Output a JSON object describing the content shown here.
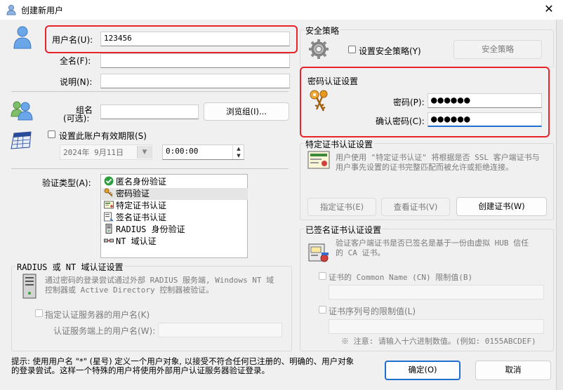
{
  "window": {
    "title": "创建新用户",
    "close_glyph": "✕"
  },
  "user": {
    "username_label": "用户名(U):",
    "username_value": "123456",
    "fullname_label": "全名(F):",
    "fullname_value": "",
    "desc_label": "说明(N):",
    "desc_value": ""
  },
  "group": {
    "label_line1": "组名",
    "label_line2": "(可选):",
    "value": "",
    "browse_button": "浏览组(I)..."
  },
  "expiry": {
    "checkbox_label": "设置此账户有效期限(S)",
    "checked": false,
    "date_value": "2024年  9月11日",
    "time_value": "0:00:00"
  },
  "auth": {
    "label": "验证类型(A):",
    "items": [
      {
        "label": "匿名身份验证",
        "icon": "check-circle-icon",
        "selected": false
      },
      {
        "label": "密码验证",
        "icon": "key-icon",
        "selected": true
      },
      {
        "label": "特定证书认证",
        "icon": "certificate-icon",
        "selected": false
      },
      {
        "label": "签名证书认证",
        "icon": "signed-certificate-icon",
        "selected": false
      },
      {
        "label": "RADIUS 身份验证",
        "icon": "server-icon",
        "selected": false
      },
      {
        "label": "NT 域认证",
        "icon": "network-icon",
        "selected": false
      }
    ]
  },
  "radius": {
    "title": "RADIUS 或 NT 域认证设置",
    "desc_line1": "通过密码的登录尝试通过外部 RADIUS 服务端, Windows NT 域",
    "desc_line2": "控制器或 Active Directory 控制器被验证。",
    "checkbox_label": "指定认证服务器的用户名(K)",
    "server_user_label": "认证服务端上的用户名(W):",
    "server_user_value": ""
  },
  "security": {
    "title": "安全策略",
    "checkbox_label": "设置安全策略(Y)",
    "button": "安全策略"
  },
  "password": {
    "title": "密码认证设置",
    "password_label": "密码(P):",
    "password_value": "●●●●●●",
    "confirm_label": "确认密码(C):",
    "confirm_value": "●●●●●●"
  },
  "cert": {
    "title": "特定证书认证设置",
    "desc_line1": "用户使用 \"特定证书认证\" 将根据是否 SSL 客户端证书与",
    "desc_line2": "用户事先设置的证书完整匹配而被允许或拒绝连接。",
    "specify_button": "指定证书(E)",
    "view_button": "查看证书(V)",
    "create_button": "创建证书(W)"
  },
  "signed": {
    "title": "已签名证书认证设置",
    "desc_line1": "验证客户端证书是否已签名是基于一份由虚拟 HUB 信任",
    "desc_line2": "的 CA 证书。",
    "cn_label": "证书的 Common Name (CN) 限制值(B)",
    "cn_value": "",
    "serial_label": "证书序列号的限制值(L)",
    "serial_value": "",
    "note": "※ 注意: 请输入十六进制数值。(例如: 0155ABCDEF)"
  },
  "hint": {
    "line1": "提示: 使用用户名 \"*\" (星号) 定义一个用户对象, 以接受不符合任何已注册的、明确的、用户对象",
    "line2": "的登录尝试。这样一个特殊的用户将使用外部用户认证服务器验证登录。"
  },
  "footer": {
    "ok_button": "确定(O)",
    "cancel_button": "取消"
  }
}
